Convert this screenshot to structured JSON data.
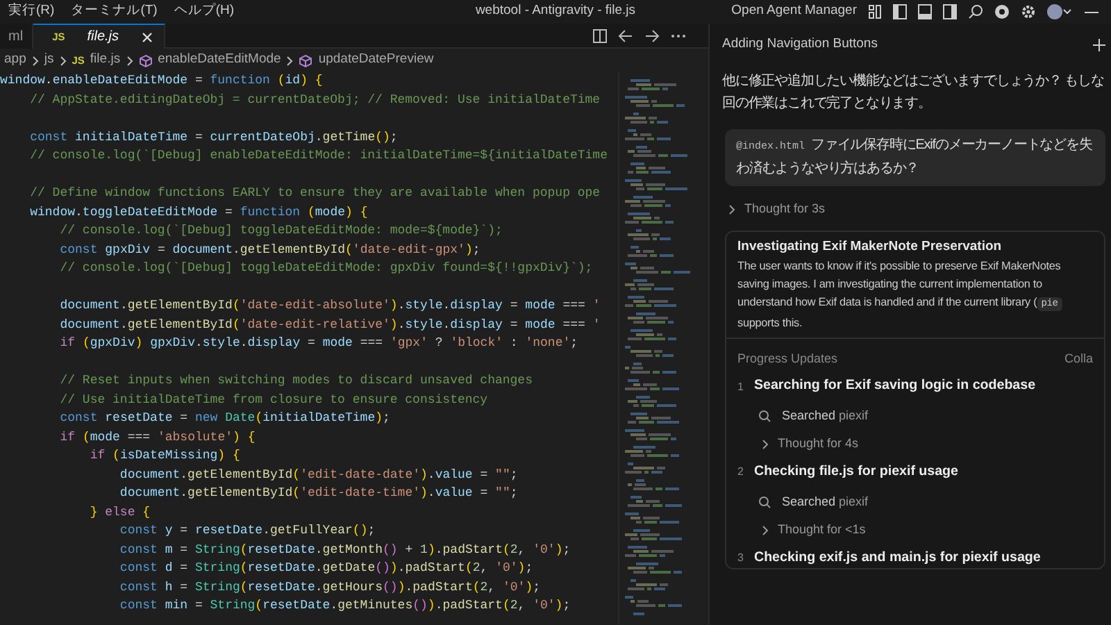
{
  "title_bar": {
    "menu": [
      "実行(R)",
      "ターミナル(T)",
      "ヘルプ(H)"
    ],
    "title": "webtool - Antigravity - file.js",
    "agent_manager_button": "Open Agent Manager"
  },
  "editor": {
    "tabs": [
      {
        "label": "ml",
        "selected": false
      },
      {
        "label": "file.js",
        "badge": "JS",
        "selected": true
      }
    ],
    "breadcrumbs": [
      {
        "label": "app",
        "kind": "folder"
      },
      {
        "label": "js",
        "kind": "folder"
      },
      {
        "label": "file.js",
        "kind": "js",
        "badge": "JS"
      },
      {
        "label": "enableDateEditMode",
        "kind": "method"
      },
      {
        "label": "updateDatePreview",
        "kind": "method"
      }
    ],
    "code_lines": [
      {
        "kind": "code",
        "text": "window.enableDateEditMode = function (id) {"
      },
      {
        "kind": "code",
        "text": "    // AppState.editingDateObj = currentDateObj; // Removed: Use initialDateTime"
      },
      {
        "kind": "blank"
      },
      {
        "kind": "code",
        "text": "    const initialDateTime = currentDateObj.getTime();"
      },
      {
        "kind": "code",
        "text": "    // console.log(`[Debug] enableDateEditMode: initialDateTime=${initialDateTime"
      },
      {
        "kind": "blank"
      },
      {
        "kind": "code",
        "text": "    // Define window functions EARLY to ensure they are available when popup ope"
      },
      {
        "kind": "code",
        "text": "    window.toggleDateEditMode = function (mode) {"
      },
      {
        "kind": "code",
        "text": "        // console.log(`[Debug] toggleDateEditMode: mode=${mode}`);"
      },
      {
        "kind": "code",
        "text": "        const gpxDiv = document.getElementById('date-edit-gpx');"
      },
      {
        "kind": "code",
        "text": "        // console.log(`[Debug] toggleDateEditMode: gpxDiv found=${!!gpxDiv}`);"
      },
      {
        "kind": "blank"
      },
      {
        "kind": "code",
        "text": "        document.getElementById('date-edit-absolute').style.display = mode === '"
      },
      {
        "kind": "code",
        "text": "        document.getElementById('date-edit-relative').style.display = mode === '"
      },
      {
        "kind": "code",
        "text": "        if (gpxDiv) gpxDiv.style.display = mode === 'gpx' ? 'block' : 'none';"
      },
      {
        "kind": "blank"
      },
      {
        "kind": "code",
        "text": "        // Reset inputs when switching modes to discard unsaved changes"
      },
      {
        "kind": "code",
        "text": "        // Use initialDateTime from closure to ensure consistency"
      },
      {
        "kind": "code",
        "text": "        const resetDate = new Date(initialDateTime);"
      },
      {
        "kind": "code",
        "text": "        if (mode === 'absolute') {"
      },
      {
        "kind": "code",
        "text": "            if (isDateMissing) {"
      },
      {
        "kind": "code",
        "text": "                document.getElementById('edit-date-date').value = \"\";"
      },
      {
        "kind": "code",
        "text": "                document.getElementById('edit-date-time').value = \"\";"
      },
      {
        "kind": "code",
        "text": "            } else {"
      },
      {
        "kind": "code",
        "text": "                const y = resetDate.getFullYear();"
      },
      {
        "kind": "code",
        "text": "                const m = String(resetDate.getMonth() + 1).padStart(2, '0');"
      },
      {
        "kind": "code",
        "text": "                const d = String(resetDate.getDate()).padStart(2, '0');"
      },
      {
        "kind": "code",
        "text": "                const h = String(resetDate.getHours()).padStart(2, '0');"
      },
      {
        "kind": "code",
        "text": "                const min = String(resetDate.getMinutes()).padStart(2, '0');"
      }
    ]
  },
  "agent_panel": {
    "title": "Adding Navigation Buttons",
    "assistant_text": "他に修正や追加したい機能などはございますでしょうか？ もしな回の作業はこれで完了となります。",
    "user_message": {
      "mention": "@index.html",
      "text": "ファイル保存時にExifのメーカーノートなどを失わ済むようなやり方はあるか？"
    },
    "thought": {
      "label": "Thought for 3s",
      "expanded": false
    },
    "task_card": {
      "title": "Investigating Exif MakerNote Preservation",
      "text_before": "The user wants to know if it's possible to preserve Exif MakerNotes\nsaving images. I am investigating the current implementation to\nunderstand how Exif data is handled and if the current library (",
      "code": "pie",
      "text_after": "\nsupports this."
    },
    "progress": {
      "heading": "Progress Updates",
      "collapse_link": "Colla",
      "steps": [
        {
          "number": "1",
          "title": "Searching for Exif saving logic in codebase",
          "items": [
            {
              "kind": "search",
              "action": "Searched",
              "target": "piexif"
            },
            {
              "kind": "thought",
              "label": "Thought for 4s",
              "expanded": false
            }
          ]
        },
        {
          "number": "2",
          "title": "Checking file.js for piexif usage",
          "items": [
            {
              "kind": "search",
              "action": "Searched",
              "target": "piexif"
            },
            {
              "kind": "thought",
              "label": "Thought for <1s",
              "expanded": false
            }
          ]
        },
        {
          "number": "3",
          "title": "Checking exif.js and main.js for piexif usage"
        }
      ]
    }
  }
}
